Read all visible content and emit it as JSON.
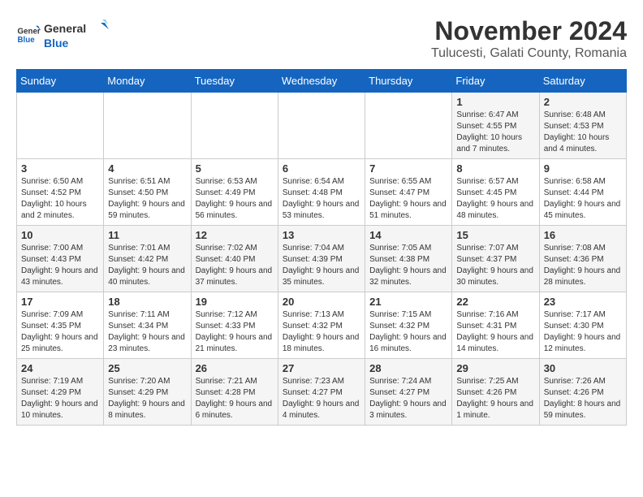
{
  "header": {
    "logo_general": "General",
    "logo_blue": "Blue",
    "month_title": "November 2024",
    "location": "Tulucesti, Galati County, Romania"
  },
  "weekdays": [
    "Sunday",
    "Monday",
    "Tuesday",
    "Wednesday",
    "Thursday",
    "Friday",
    "Saturday"
  ],
  "weeks": [
    [
      {
        "day": "",
        "info": ""
      },
      {
        "day": "",
        "info": ""
      },
      {
        "day": "",
        "info": ""
      },
      {
        "day": "",
        "info": ""
      },
      {
        "day": "",
        "info": ""
      },
      {
        "day": "1",
        "info": "Sunrise: 6:47 AM\nSunset: 4:55 PM\nDaylight: 10 hours and 7 minutes."
      },
      {
        "day": "2",
        "info": "Sunrise: 6:48 AM\nSunset: 4:53 PM\nDaylight: 10 hours and 4 minutes."
      }
    ],
    [
      {
        "day": "3",
        "info": "Sunrise: 6:50 AM\nSunset: 4:52 PM\nDaylight: 10 hours and 2 minutes."
      },
      {
        "day": "4",
        "info": "Sunrise: 6:51 AM\nSunset: 4:50 PM\nDaylight: 9 hours and 59 minutes."
      },
      {
        "day": "5",
        "info": "Sunrise: 6:53 AM\nSunset: 4:49 PM\nDaylight: 9 hours and 56 minutes."
      },
      {
        "day": "6",
        "info": "Sunrise: 6:54 AM\nSunset: 4:48 PM\nDaylight: 9 hours and 53 minutes."
      },
      {
        "day": "7",
        "info": "Sunrise: 6:55 AM\nSunset: 4:47 PM\nDaylight: 9 hours and 51 minutes."
      },
      {
        "day": "8",
        "info": "Sunrise: 6:57 AM\nSunset: 4:45 PM\nDaylight: 9 hours and 48 minutes."
      },
      {
        "day": "9",
        "info": "Sunrise: 6:58 AM\nSunset: 4:44 PM\nDaylight: 9 hours and 45 minutes."
      }
    ],
    [
      {
        "day": "10",
        "info": "Sunrise: 7:00 AM\nSunset: 4:43 PM\nDaylight: 9 hours and 43 minutes."
      },
      {
        "day": "11",
        "info": "Sunrise: 7:01 AM\nSunset: 4:42 PM\nDaylight: 9 hours and 40 minutes."
      },
      {
        "day": "12",
        "info": "Sunrise: 7:02 AM\nSunset: 4:40 PM\nDaylight: 9 hours and 37 minutes."
      },
      {
        "day": "13",
        "info": "Sunrise: 7:04 AM\nSunset: 4:39 PM\nDaylight: 9 hours and 35 minutes."
      },
      {
        "day": "14",
        "info": "Sunrise: 7:05 AM\nSunset: 4:38 PM\nDaylight: 9 hours and 32 minutes."
      },
      {
        "day": "15",
        "info": "Sunrise: 7:07 AM\nSunset: 4:37 PM\nDaylight: 9 hours and 30 minutes."
      },
      {
        "day": "16",
        "info": "Sunrise: 7:08 AM\nSunset: 4:36 PM\nDaylight: 9 hours and 28 minutes."
      }
    ],
    [
      {
        "day": "17",
        "info": "Sunrise: 7:09 AM\nSunset: 4:35 PM\nDaylight: 9 hours and 25 minutes."
      },
      {
        "day": "18",
        "info": "Sunrise: 7:11 AM\nSunset: 4:34 PM\nDaylight: 9 hours and 23 minutes."
      },
      {
        "day": "19",
        "info": "Sunrise: 7:12 AM\nSunset: 4:33 PM\nDaylight: 9 hours and 21 minutes."
      },
      {
        "day": "20",
        "info": "Sunrise: 7:13 AM\nSunset: 4:32 PM\nDaylight: 9 hours and 18 minutes."
      },
      {
        "day": "21",
        "info": "Sunrise: 7:15 AM\nSunset: 4:32 PM\nDaylight: 9 hours and 16 minutes."
      },
      {
        "day": "22",
        "info": "Sunrise: 7:16 AM\nSunset: 4:31 PM\nDaylight: 9 hours and 14 minutes."
      },
      {
        "day": "23",
        "info": "Sunrise: 7:17 AM\nSunset: 4:30 PM\nDaylight: 9 hours and 12 minutes."
      }
    ],
    [
      {
        "day": "24",
        "info": "Sunrise: 7:19 AM\nSunset: 4:29 PM\nDaylight: 9 hours and 10 minutes."
      },
      {
        "day": "25",
        "info": "Sunrise: 7:20 AM\nSunset: 4:29 PM\nDaylight: 9 hours and 8 minutes."
      },
      {
        "day": "26",
        "info": "Sunrise: 7:21 AM\nSunset: 4:28 PM\nDaylight: 9 hours and 6 minutes."
      },
      {
        "day": "27",
        "info": "Sunrise: 7:23 AM\nSunset: 4:27 PM\nDaylight: 9 hours and 4 minutes."
      },
      {
        "day": "28",
        "info": "Sunrise: 7:24 AM\nSunset: 4:27 PM\nDaylight: 9 hours and 3 minutes."
      },
      {
        "day": "29",
        "info": "Sunrise: 7:25 AM\nSunset: 4:26 PM\nDaylight: 9 hours and 1 minute."
      },
      {
        "day": "30",
        "info": "Sunrise: 7:26 AM\nSunset: 4:26 PM\nDaylight: 8 hours and 59 minutes."
      }
    ]
  ]
}
